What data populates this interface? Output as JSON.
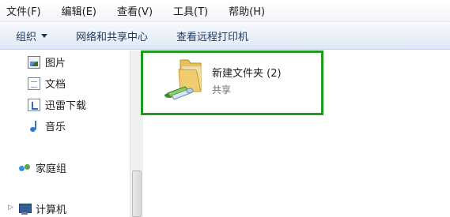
{
  "menubar": {
    "items": [
      "文件(F)",
      "编辑(E)",
      "查看(V)",
      "工具(T)",
      "帮助(H)"
    ]
  },
  "toolbar": {
    "organize": "组织",
    "network_center": "网络和共享中心",
    "remote_printers": "查看远程打印机"
  },
  "navpane": {
    "items": [
      {
        "label": "图片",
        "icon": "pictures-icon"
      },
      {
        "label": "文档",
        "icon": "document-icon"
      },
      {
        "label": "迅雷下载",
        "icon": "xunlei-download-icon"
      },
      {
        "label": "音乐",
        "icon": "music-icon"
      },
      {
        "label": "家庭组",
        "icon": "homegroup-icon"
      },
      {
        "label": "计算机",
        "icon": "computer-icon"
      }
    ]
  },
  "content": {
    "folder": {
      "name": "新建文件夹 (2)",
      "status": "共享",
      "icon": "shared-folder-icon"
    }
  },
  "colors": {
    "highlight": "#1f9a1f",
    "toolbar_text": "#1e395b"
  }
}
